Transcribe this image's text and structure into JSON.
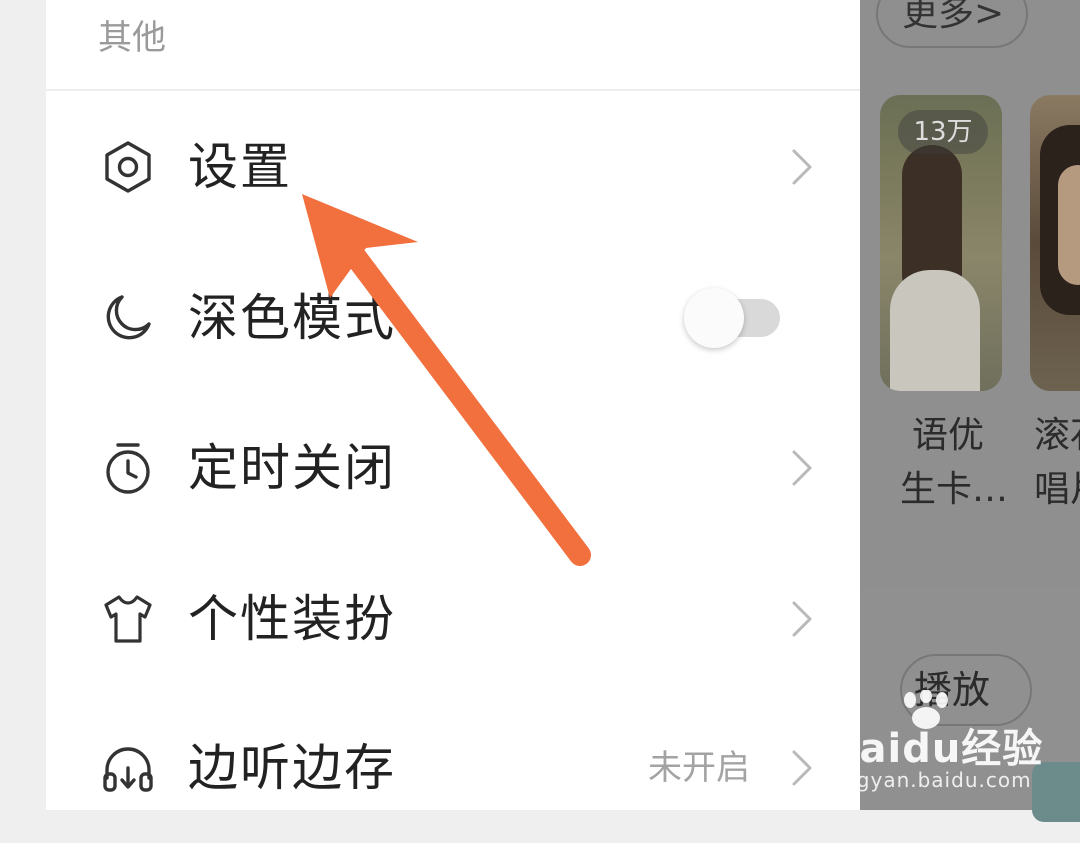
{
  "drawer": {
    "section_title": "其他",
    "items": [
      {
        "label": "设置",
        "icon": "settings-hexagon-icon",
        "trailing": "chevron"
      },
      {
        "label": "深色模式",
        "icon": "moon-icon",
        "trailing": "toggle",
        "toggle_on": false
      },
      {
        "label": "定时关闭",
        "icon": "timer-icon",
        "trailing": "chevron"
      },
      {
        "label": "个性装扮",
        "icon": "tshirt-icon",
        "trailing": "chevron"
      },
      {
        "label": "边听边存",
        "icon": "headphones-download-icon",
        "trailing": "chevron",
        "status": "未开启"
      }
    ]
  },
  "background": {
    "more_label": "更多>",
    "badge": "13万",
    "card1_lines": [
      "语优",
      "生卡…"
    ],
    "card2_lines": [
      "滚石",
      "唱片"
    ],
    "play_label": "播放"
  },
  "watermark": {
    "brand": "Baidu经验",
    "url": "jingyan.baidu.com"
  },
  "colors": {
    "arrow": "#f26f3e",
    "label": "#222222",
    "muted": "#9a9a9a"
  }
}
